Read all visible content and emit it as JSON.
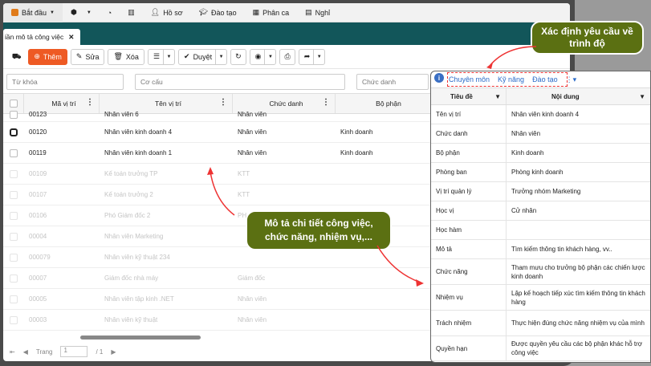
{
  "menu": [
    {
      "label": "Bắt đầu",
      "icon": "home-icon"
    },
    {
      "label": "",
      "icon": "cube-icon"
    },
    {
      "label": "",
      "icon": "dashboard-icon"
    },
    {
      "label": "",
      "icon": "chart-icon"
    },
    {
      "label": "Hồ sơ",
      "icon": "user-icon"
    },
    {
      "label": "Đào tạo",
      "icon": "graduation-icon"
    },
    {
      "label": "Phân ca",
      "icon": "calendar-icon"
    },
    {
      "label": "Nghỉ",
      "icon": "leave-icon"
    }
  ],
  "tab": {
    "label": "iần mô tả công việc"
  },
  "toolbar": {
    "add": "Thêm",
    "edit": "Sửa",
    "delete": "Xóa",
    "approve": "Duyệt"
  },
  "filters": {
    "keyword": "Từ khóa",
    "structure": "Cơ cấu",
    "title": "Chức danh"
  },
  "grid": {
    "headers": [
      "Mã vị trí",
      "Tên vị trí",
      "Chức danh",
      "Bộ phận"
    ],
    "rows": [
      [
        "00123",
        "Nhân viên 6",
        "Nhân viên",
        ""
      ],
      [
        "00120",
        "Nhân viên kinh doanh 4",
        "Nhân viên",
        "Kinh doanh"
      ],
      [
        "00119",
        "Nhân viên kinh doanh 1",
        "Nhân viên",
        "Kinh doanh"
      ],
      [
        "00109",
        "Kế toán trưởng TP",
        "KTT",
        ""
      ],
      [
        "00107",
        "Kế toán trưởng 2",
        "KTT",
        ""
      ],
      [
        "00106",
        "Phó Giám đốc 2",
        "PH",
        ""
      ],
      [
        "00004",
        "Nhân viên Marketing",
        "",
        ""
      ],
      [
        "000079",
        "Nhân viên kỹ thuật 234",
        "",
        ""
      ],
      [
        "00007",
        "Giám đốc nhà máy",
        "Giám đốc",
        ""
      ],
      [
        "00005",
        "Nhân viên tập kinh .NET",
        "Nhân viên",
        ""
      ],
      [
        "00003",
        "Nhân viên kỹ thuật",
        "Nhân viên",
        ""
      ]
    ]
  },
  "pager": {
    "label": "Trang",
    "page": "1",
    "of": "/ 1"
  },
  "callouts": {
    "top": "Xác định yêu cầu về trình độ",
    "middle": "Mô tả chi tiết công việc, chức năng, nhiệm vụ,..."
  },
  "panel": {
    "tabs": [
      "Chuyên môn",
      "Kỹ năng",
      "Đào tạo"
    ],
    "header_key": "Tiêu đề",
    "header_val": "Nội dung",
    "rows": [
      [
        "Tên vị trí",
        "Nhân viên kinh doanh 4"
      ],
      [
        "Chức danh",
        "Nhân viên"
      ],
      [
        "Bộ phận",
        "Kinh doanh"
      ],
      [
        "Phòng ban",
        "Phòng kinh doanh"
      ],
      [
        "Vị trí quản lý",
        "Trưởng nhóm Marketing"
      ],
      [
        "Học vị",
        "Cử nhân"
      ],
      [
        "Học hàm",
        ""
      ],
      [
        "Mô tả",
        "Tìm kiếm thông tin khách hàng, vv.."
      ],
      [
        "Chức năng",
        "Tham mưu cho trưởng bộ phận các chiến lược kinh doanh"
      ],
      [
        "Nhiệm vụ",
        "Lập kế hoạch tiếp xúc tìm kiếm thông tin khách hàng"
      ],
      [
        "Trách nhiệm",
        "Thực hiện đúng chức năng nhiệm vụ của mình"
      ],
      [
        "Quyền hạn",
        "Được quyền yêu cầu các bộ phận khác hỗ trợ công việc"
      ]
    ]
  },
  "colors": {
    "accent": "#ee5a24",
    "teal": "#12565a",
    "callout": "#5b7012",
    "link": "#2a6bc9"
  }
}
